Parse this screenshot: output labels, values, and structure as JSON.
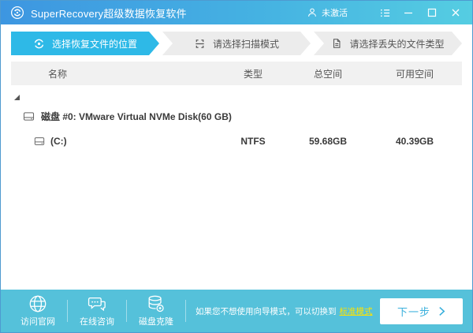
{
  "titlebar": {
    "title": "SuperRecovery超级数据恢复软件",
    "activation": "未激活"
  },
  "steps": [
    {
      "label": "选择恢复文件的位置",
      "active": true
    },
    {
      "label": "请选择扫描模式",
      "active": false
    },
    {
      "label": "请选择丢失的文件类型",
      "active": false
    }
  ],
  "table": {
    "headers": {
      "name": "名称",
      "type": "类型",
      "total": "总空间",
      "free": "可用空间"
    }
  },
  "tree": {
    "disk_name": "磁盘 #0: VMware Virtual NVMe Disk(60 GB)",
    "volume": {
      "name": "(C:)",
      "type": "NTFS",
      "total": "59.68GB",
      "free": "40.39GB"
    }
  },
  "footer": {
    "visit_site": "访问官网",
    "online_support": "在线咨询",
    "disk_clone": "磁盘克隆",
    "hint_text": "如果您不想使用向导模式，可以切换到",
    "hint_link": "标准模式",
    "next_button": "下一步"
  },
  "colors": {
    "titlebar_gradient_start": "#3d96e1",
    "titlebar_gradient_end": "#55cde2",
    "active_step": "#2eb9e7",
    "footer_bg": "#55c1da",
    "link_yellow": "#ffe400",
    "button_text": "#3ab0dc",
    "window_border": "#4e9ad0"
  }
}
